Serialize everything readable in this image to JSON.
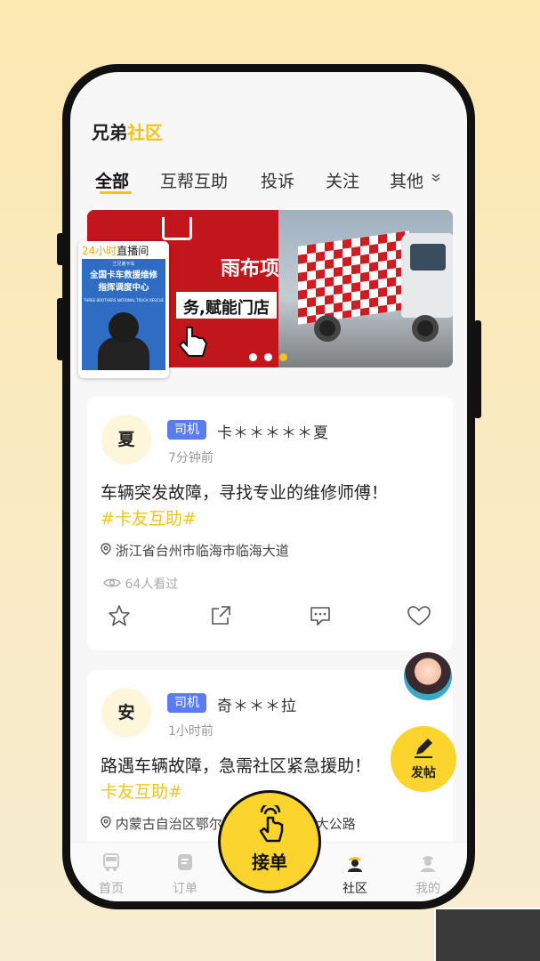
{
  "header": {
    "brand_part1": "兄弟",
    "brand_part2": "社区"
  },
  "tabs": [
    {
      "label": "全部",
      "active": true
    },
    {
      "label": "互帮互助",
      "active": false
    },
    {
      "label": "投诉",
      "active": false
    },
    {
      "label": "关注",
      "active": false
    },
    {
      "label": "其他",
      "active": false
    }
  ],
  "banner": {
    "title": "雨布项目",
    "subtitle": "务,赋能门店",
    "active_dot": 3,
    "dot_count": 3
  },
  "live": {
    "label_highlight": "24小时",
    "label_rest": "直播间",
    "small_text": "兰兄弟卡车",
    "title_line1": "全国卡车救援维修",
    "title_line2": "指挥调度中心",
    "eng_text": "THREE BROTHERS NATIONAL TRUCK RESCUE"
  },
  "posts": [
    {
      "avatar_char": "夏",
      "role": "司机",
      "user_name": "卡＊＊＊＊＊夏",
      "time": "7分钟前",
      "content": "车辆突发故障，寻找专业的维修师傅！",
      "tag": "#卡友互助#",
      "location": "浙江省台州市临海市临海大道",
      "views": "64人看过"
    },
    {
      "avatar_char": "安",
      "role": "司机",
      "user_name": "奇＊＊＊拉",
      "time": "1小时前",
      "content": "路遇车辆故障，急需社区紧急援助！",
      "tag": "卡友互助#",
      "location": "内蒙古自治区鄂尔多斯市乌审旗呼大公路"
    }
  ],
  "fab": {
    "label": "发帖"
  },
  "accept_button": {
    "label": "接单"
  },
  "bottom_nav": [
    {
      "label": "首页",
      "active": false
    },
    {
      "label": "订单",
      "active": false
    },
    {
      "label": "社区",
      "active": true
    },
    {
      "label": "我的",
      "active": false
    }
  ],
  "colors": {
    "accent": "#f4c31d",
    "badge": "#5a7cf0",
    "banner_red": "#c1161b"
  }
}
